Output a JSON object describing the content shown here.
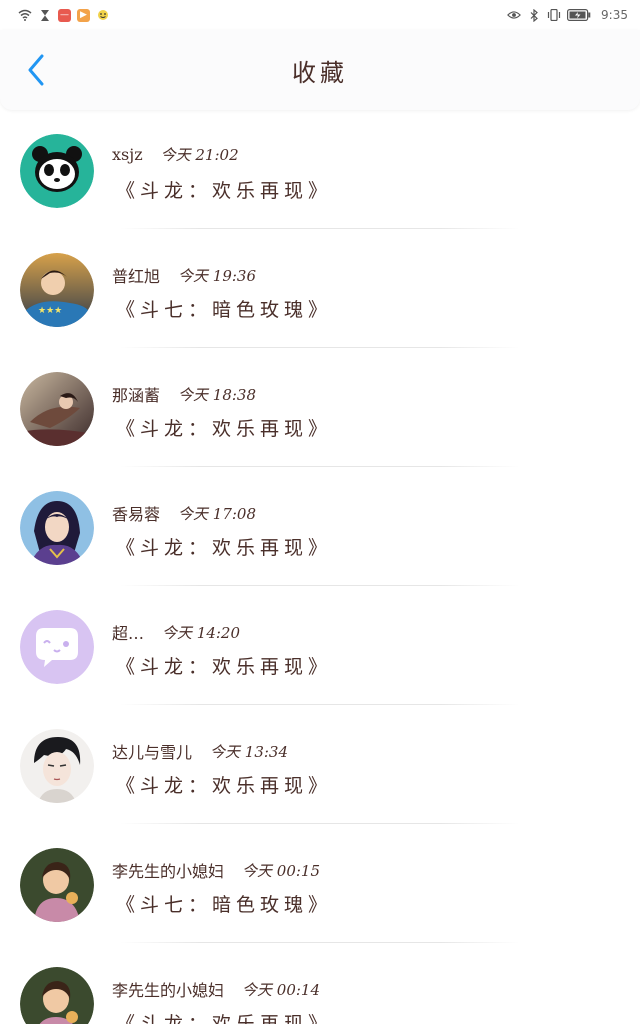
{
  "status_bar": {
    "time": "9:35",
    "icons": [
      "wifi-icon",
      "hourglass-icon",
      "app-red-icon",
      "app-orange-icon",
      "emoji-icon",
      "eye-icon",
      "bluetooth-icon",
      "vibrate-icon",
      "battery-icon"
    ]
  },
  "header": {
    "title": "收藏",
    "back_icon": "chevron-left-icon",
    "accent_color": "#2196f3"
  },
  "items": [
    {
      "username": "xsjz",
      "time": "今天 21:02",
      "title": "《斗龙：欢乐再现》",
      "avatar": "panda-avatar"
    },
    {
      "username": "普红旭",
      "time": "今天 19:36",
      "title": "《斗七：暗色玫瑰》",
      "avatar": "photo-avatar"
    },
    {
      "username": "那涵蓄",
      "time": "今天 18:38",
      "title": "《斗龙：欢乐再现》",
      "avatar": "illustration-avatar"
    },
    {
      "username": "香易蓉",
      "time": "今天 17:08",
      "title": "《斗龙：欢乐再现》",
      "avatar": "anime-avatar"
    },
    {
      "username": "超…",
      "time": "今天 14:20",
      "title": "《斗龙：欢乐再现》",
      "avatar": "chat-bubble-avatar"
    },
    {
      "username": "达儿与雪儿",
      "time": "今天 13:34",
      "title": "《斗龙：欢乐再现》",
      "avatar": "sketch-avatar"
    },
    {
      "username": "李先生的小媳妇",
      "time": "今天 00:15",
      "title": "《斗七：暗色玫瑰》",
      "avatar": "child-photo-avatar"
    },
    {
      "username": "李先生的小媳妇",
      "time": "今天 00:14",
      "title": "《斗龙：欢乐再现》",
      "avatar": "child-photo-avatar"
    }
  ]
}
